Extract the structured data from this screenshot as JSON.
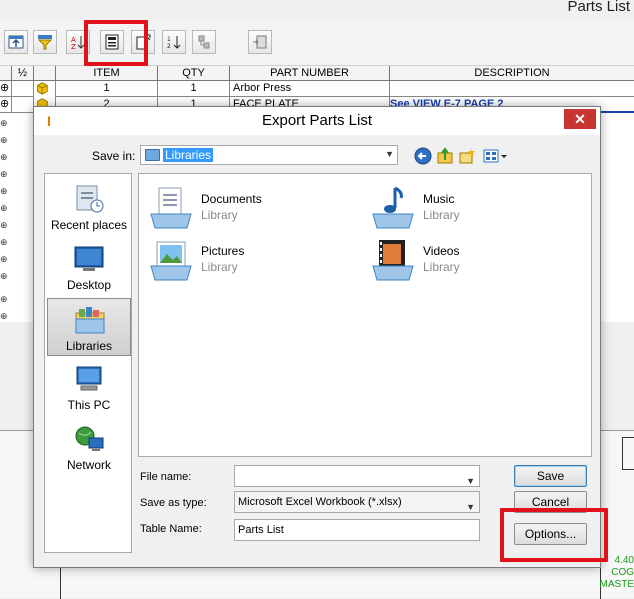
{
  "app": {
    "title": "Parts List"
  },
  "grid": {
    "columns": [
      "ITEM",
      "QTY",
      "PART NUMBER",
      "DESCRIPTION"
    ],
    "corner_label": "½",
    "rows": [
      {
        "item": "1",
        "qty": "1",
        "part_number": "Arbor Press",
        "description": ""
      },
      {
        "item": "2",
        "qty": "1",
        "part_number": "FACE PLATE",
        "description": "See VIEW E-7 PAGE 2"
      }
    ]
  },
  "drawing": {
    "text_1": "4.40",
    "text_2": "COG",
    "text_3": "MASTE"
  },
  "dialog": {
    "title": "Export Parts List",
    "save_in_label": "Save in:",
    "save_in_value": "Libraries",
    "places": [
      {
        "label": "Recent places",
        "icon": "recent-places-icon"
      },
      {
        "label": "Desktop",
        "icon": "desktop-icon"
      },
      {
        "label": "Libraries",
        "icon": "libraries-icon"
      },
      {
        "label": "This PC",
        "icon": "this-pc-icon"
      },
      {
        "label": "Network",
        "icon": "network-icon"
      }
    ],
    "libraries": [
      {
        "name": "Documents",
        "type": "Library",
        "icon": "documents-library-icon"
      },
      {
        "name": "Music",
        "type": "Library",
        "icon": "music-library-icon"
      },
      {
        "name": "Pictures",
        "type": "Library",
        "icon": "pictures-library-icon"
      },
      {
        "name": "Videos",
        "type": "Library",
        "icon": "videos-library-icon"
      }
    ],
    "file_name_label": "File name:",
    "file_name_value": "",
    "save_as_type_label": "Save as type:",
    "save_as_type_value": "Microsoft Excel Workbook (*.xlsx)",
    "table_name_label": "Table Name:",
    "table_name_value": "Parts List",
    "save_button": "Save",
    "cancel_button": "Cancel",
    "options_button": "Options...",
    "close_glyph": "✕",
    "app_icon_glyph": "I"
  },
  "colors": {
    "highlight": "#e0111b",
    "selection": "#3399ff",
    "close": "#c7362f"
  }
}
